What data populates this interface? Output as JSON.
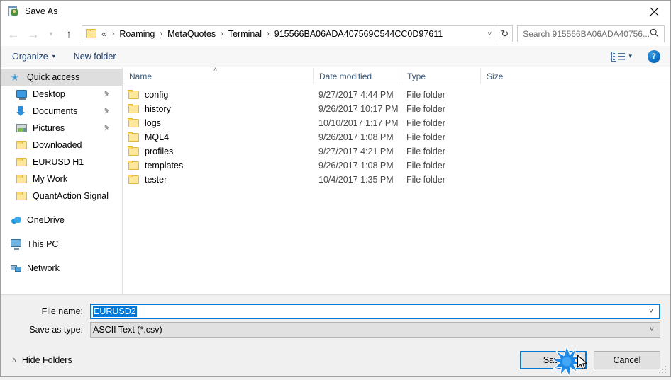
{
  "window": {
    "title": "Save As",
    "title_icon": "save-as-icon",
    "close_label": "Close"
  },
  "nav": {
    "back": "back-arrow",
    "forward": "forward-arrow",
    "recent": "recent-locations-chevron",
    "up": "up-arrow",
    "breadcrumb": {
      "leading": "«",
      "crumbs": [
        "Roaming",
        "MetaQuotes",
        "Terminal",
        "915566BA06ADA407569C544CC0D97611"
      ],
      "separator": "›",
      "dropdown": "˅",
      "refresh": "↻"
    },
    "search": {
      "placeholder": "Search 915566BA06ADA40756...",
      "value": "",
      "icon": "search-icon"
    }
  },
  "toolbar": {
    "organize_label": "Organize",
    "organize_caret": "▾",
    "new_folder_label": "New folder",
    "view_icon": "view-options-icon",
    "view_caret": "▾",
    "help_label": "?"
  },
  "sidebar": {
    "items": [
      {
        "label": "Quick access",
        "icon": "quick-access-star-icon",
        "selected": true,
        "pinned": false,
        "group": 0
      },
      {
        "label": "Desktop",
        "icon": "desktop-icon",
        "selected": false,
        "pinned": true,
        "group": 0
      },
      {
        "label": "Documents",
        "icon": "documents-icon",
        "selected": false,
        "pinned": true,
        "group": 0
      },
      {
        "label": "Pictures",
        "icon": "pictures-icon",
        "selected": false,
        "pinned": true,
        "group": 0
      },
      {
        "label": "Downloaded",
        "icon": "folder-icon",
        "selected": false,
        "pinned": false,
        "group": 0
      },
      {
        "label": "EURUSD H1",
        "icon": "folder-icon",
        "selected": false,
        "pinned": false,
        "group": 0
      },
      {
        "label": "My Work",
        "icon": "folder-icon",
        "selected": false,
        "pinned": false,
        "group": 0
      },
      {
        "label": "QuantAction Signal",
        "icon": "folder-icon",
        "selected": false,
        "pinned": false,
        "group": 0
      },
      {
        "label": "OneDrive",
        "icon": "onedrive-icon",
        "selected": false,
        "pinned": false,
        "group": 1
      },
      {
        "label": "This PC",
        "icon": "this-pc-icon",
        "selected": false,
        "pinned": false,
        "group": 2
      },
      {
        "label": "Network",
        "icon": "network-icon",
        "selected": false,
        "pinned": false,
        "group": 3
      }
    ]
  },
  "filelist": {
    "columns": [
      "Name",
      "Date modified",
      "Type",
      "Size"
    ],
    "sort_indicator": "˄",
    "rows": [
      {
        "name": "config",
        "date": "9/27/2017 4:44 PM",
        "type": "File folder",
        "size": ""
      },
      {
        "name": "history",
        "date": "9/26/2017 10:17 PM",
        "type": "File folder",
        "size": ""
      },
      {
        "name": "logs",
        "date": "10/10/2017 1:17 PM",
        "type": "File folder",
        "size": ""
      },
      {
        "name": "MQL4",
        "date": "9/26/2017 1:08 PM",
        "type": "File folder",
        "size": ""
      },
      {
        "name": "profiles",
        "date": "9/27/2017 4:21 PM",
        "type": "File folder",
        "size": ""
      },
      {
        "name": "templates",
        "date": "9/26/2017 1:08 PM",
        "type": "File folder",
        "size": ""
      },
      {
        "name": "tester",
        "date": "10/4/2017 1:35 PM",
        "type": "File folder",
        "size": ""
      }
    ]
  },
  "form": {
    "filename_label": "File name:",
    "filename_value": "EURUSD2",
    "filetype_label": "Save as type:",
    "filetype_value": "ASCII Text (*.csv)",
    "dropdown_glyph": "˅"
  },
  "footer": {
    "hide_folders_label": "Hide Folders",
    "hide_folders_caret": "˄",
    "save_label": "Save",
    "cancel_label": "Cancel"
  },
  "colors": {
    "accent": "#0078d7",
    "folder_fill": "#fde79a",
    "folder_stroke": "#e0b93d",
    "chrome_bg": "#f0f0f0",
    "selection": "#0078d7",
    "sidebar_selected": "#dedede"
  }
}
